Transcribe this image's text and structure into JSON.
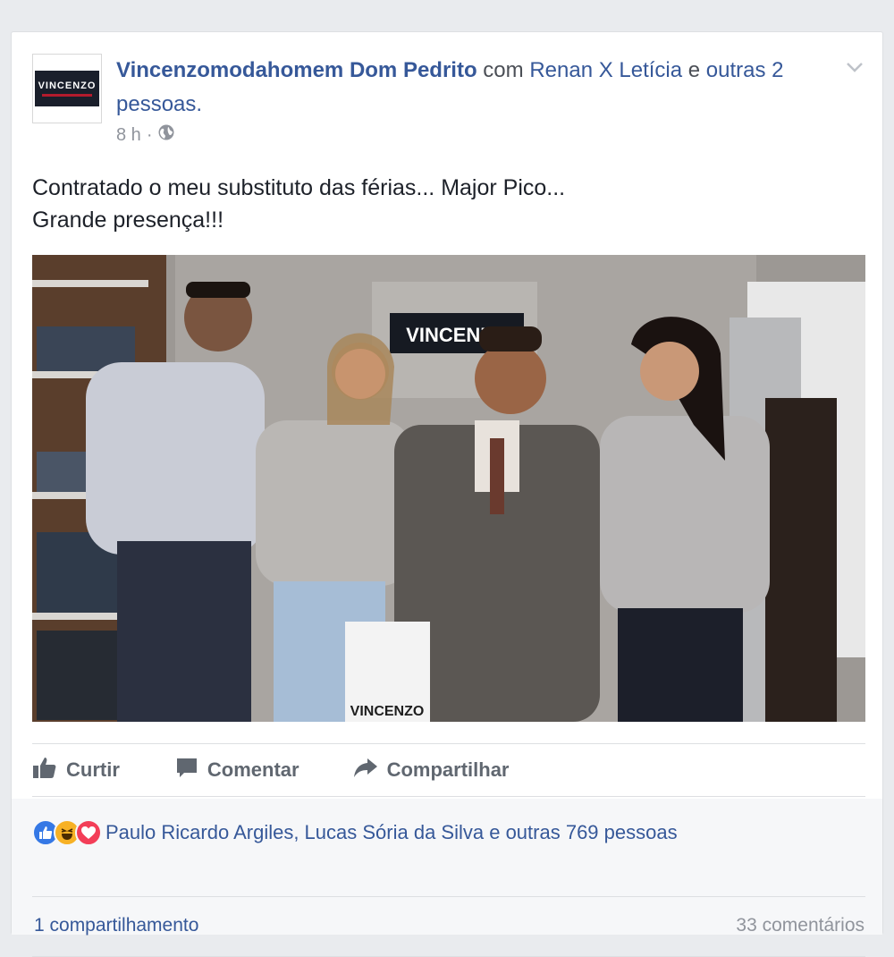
{
  "post": {
    "avatar_text": "VINCENZO",
    "author": "Vincenzomodahomem Dom Pedrito",
    "with_word": "com",
    "tagged_name": "Renan X Letícia",
    "and_word": "e",
    "others": "outras 2 pessoas.",
    "time": "8 h",
    "separator": "·",
    "privacy_icon": "globe-icon",
    "text_line1": "Contratado o meu substituto das férias... Major Pico...",
    "text_line2": "Grande presença!!!",
    "photo_sign": "VINCENZO",
    "photo_bag": "VINCENZO"
  },
  "actions": {
    "like": "Curtir",
    "comment": "Comentar",
    "share": "Compartilhar"
  },
  "reactions": {
    "types": [
      "like",
      "haha",
      "love"
    ],
    "names": "Paulo Ricardo Argiles, Lucas Sória da Silva e outras 769 pessoas"
  },
  "footer": {
    "shares": "1 compartilhamento",
    "comments": "33 comentários"
  },
  "colors": {
    "link": "#365899",
    "like": "#3578e5",
    "haha": "#f7b125",
    "love": "#f33e58"
  }
}
